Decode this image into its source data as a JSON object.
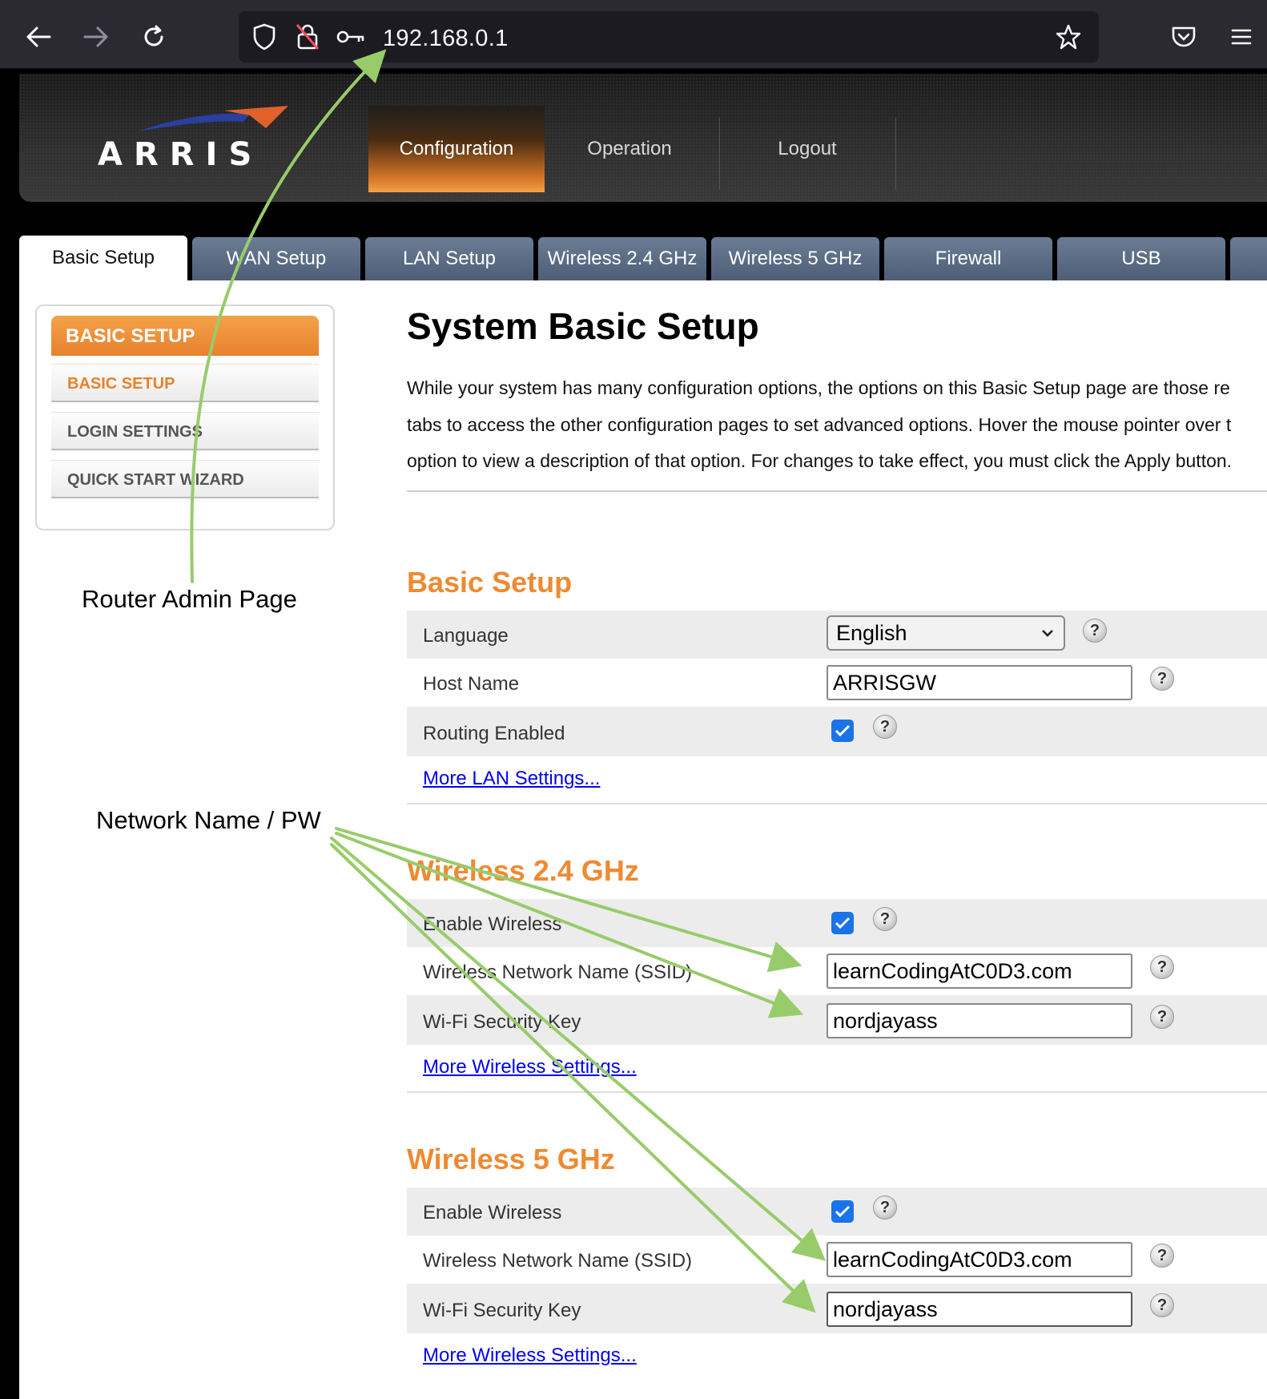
{
  "browser": {
    "url": "192.168.0.1"
  },
  "router": {
    "logo_text": "ARRIS",
    "main_tabs": [
      {
        "label": "Configuration",
        "active": true
      },
      {
        "label": "Operation",
        "active": false
      },
      {
        "label": "Logout",
        "active": false
      }
    ],
    "sub_tabs": [
      {
        "label": "Basic Setup",
        "active": true
      },
      {
        "label": "WAN Setup"
      },
      {
        "label": "LAN Setup"
      },
      {
        "label": "Wireless 2.4 GHz"
      },
      {
        "label": "Wireless 5 GHz"
      },
      {
        "label": "Firewall"
      },
      {
        "label": "USB"
      }
    ]
  },
  "sidebar": {
    "header": "BASIC SETUP",
    "items": [
      {
        "label": "BASIC SETUP",
        "active": true
      },
      {
        "label": "LOGIN SETTINGS"
      },
      {
        "label": "QUICK START WIZARD"
      }
    ]
  },
  "main": {
    "title": "System Basic Setup",
    "intro": [
      "While your system has many configuration options, the options on this Basic Setup page are those re",
      "tabs to access the other configuration pages to set advanced options. Hover the mouse pointer over t",
      "option to view a description of that option. For changes to take effect, you must click the Apply button."
    ],
    "help_glyph": "?",
    "basic": {
      "title": "Basic Setup",
      "language_label": "Language",
      "language_value": "English",
      "host_label": "Host Name",
      "host_value": "ARRISGW",
      "routing_label": "Routing Enabled",
      "routing_checked": true,
      "more_link": "More LAN Settings..."
    },
    "w24": {
      "title": "Wireless 2.4 GHz",
      "enable_label": "Enable Wireless",
      "enable_checked": true,
      "ssid_label": "Wireless Network Name (SSID)",
      "ssid_value": "learnCodingAtC0D3.com",
      "key_label": "Wi-Fi Security Key",
      "key_value": "nordjayass",
      "more_link": "More Wireless Settings..."
    },
    "w5": {
      "title": "Wireless 5 GHz",
      "enable_label": "Enable Wireless",
      "enable_checked": true,
      "ssid_label": "Wireless Network Name (SSID)",
      "ssid_value": "learnCodingAtC0D3.com",
      "key_label": "Wi-Fi Security Key",
      "key_value": "nordjayass",
      "more_link": "More Wireless Settings..."
    }
  },
  "annotations": {
    "router_admin": "Router Admin Page",
    "network_name": "Network Name / PW",
    "arrow_color": "#98cc6a"
  },
  "colors": {
    "accent_orange": "#ee8a32",
    "tab_blue": "#5b6b85",
    "checkbox_blue": "#1a73e8",
    "link_blue": "#0000ee"
  }
}
